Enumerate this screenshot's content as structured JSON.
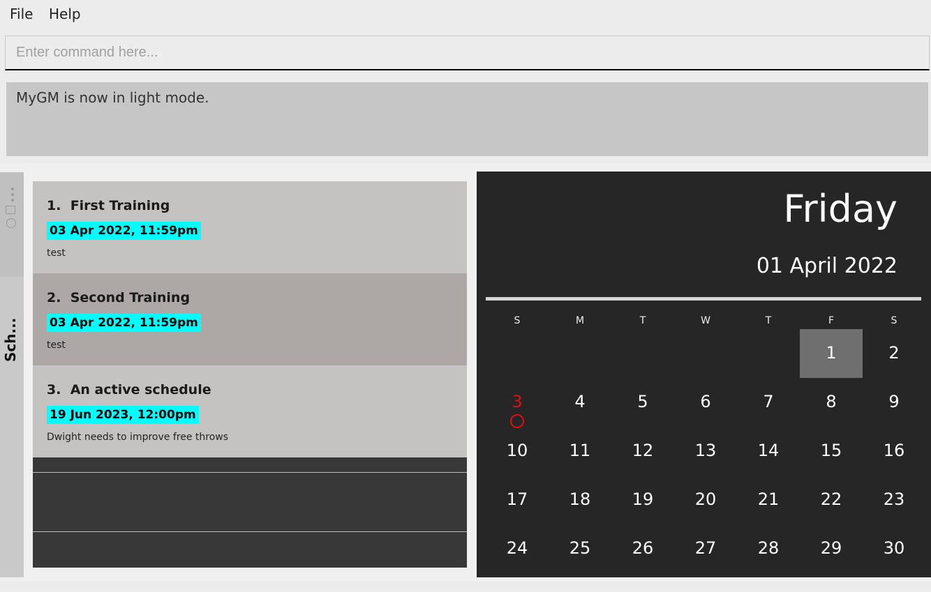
{
  "menu": {
    "file": "File",
    "help": "Help"
  },
  "command": {
    "placeholder": "Enter command here...",
    "value": ""
  },
  "result": {
    "message": "MyGM is now in light mode."
  },
  "tabs": {
    "schedule_label": "Sch..."
  },
  "schedules": [
    {
      "index": "1.",
      "title": "First Training",
      "datetime": "03 Apr 2022, 11:59pm",
      "description": "test"
    },
    {
      "index": "2.",
      "title": "Second Training",
      "datetime": "03 Apr 2022, 11:59pm",
      "description": "test"
    },
    {
      "index": "3.",
      "title": "An active schedule",
      "datetime": "19 Jun 2023, 12:00pm",
      "description": "Dwight needs to improve free throws"
    }
  ],
  "calendar": {
    "day_name": "Friday",
    "full_date": "01 April 2022",
    "weekdays": [
      "S",
      "M",
      "T",
      "W",
      "T",
      "F",
      "S"
    ],
    "weeks": [
      [
        "",
        "",
        "",
        "",
        "",
        "1",
        "2"
      ],
      [
        "3",
        "4",
        "5",
        "6",
        "7",
        "8",
        "9"
      ],
      [
        "10",
        "11",
        "12",
        "13",
        "14",
        "15",
        "16"
      ],
      [
        "17",
        "18",
        "19",
        "20",
        "21",
        "22",
        "23"
      ],
      [
        "24",
        "25",
        "26",
        "27",
        "28",
        "29",
        "30"
      ]
    ],
    "selected_day": "1",
    "event_days": [
      "3"
    ],
    "colors": {
      "background": "#262626",
      "selected": "#6f6f6f",
      "event": "#e01010"
    }
  },
  "colors": {
    "date_badge": "#00ffff",
    "card": "#c4c3c1",
    "card_selected": "#ada8a5"
  }
}
